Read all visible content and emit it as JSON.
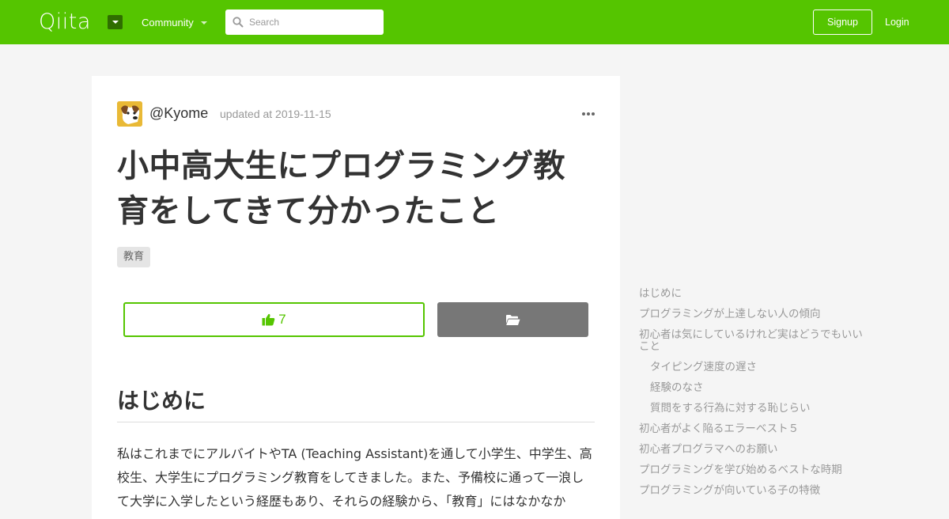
{
  "header": {
    "logo": "Qiita",
    "community_label": "Community",
    "search_placeholder": "Search",
    "signup_label": "Signup",
    "login_label": "Login",
    "brand_color": "#55c500"
  },
  "article": {
    "author": "@Kyome",
    "updated": "updated at 2019-11-15",
    "title": "小中高大生にプログラミング教育をしてきて分かったこと",
    "tags": [
      "教育"
    ],
    "like_count": "7",
    "section_heading": "はじめに",
    "paragraph": "私はこれまでにアルバイトやTA (Teaching Assistant)を通して小学生、中学生、高校生、大学生にプログラミング教育をしてきました。また、予備校に通って一浪して大学に入学したという経歴もあり、それらの経験から、「教育」にはなかなか"
  },
  "toc": [
    {
      "label": "はじめに",
      "level": 1
    },
    {
      "label": "プログラミングが上達しない人の傾向",
      "level": 1
    },
    {
      "label": "初心者は気にしているけれど実はどうでもいいこと",
      "level": 1
    },
    {
      "label": "タイピング速度の遅さ",
      "level": 2
    },
    {
      "label": "経験のなさ",
      "level": 2
    },
    {
      "label": "質問をする行為に対する恥じらい",
      "level": 2
    },
    {
      "label": "初心者がよく陥るエラーベスト５",
      "level": 1
    },
    {
      "label": "初心者プログラマへのお願い",
      "level": 1
    },
    {
      "label": "プログラミングを学び始めるベストな時期",
      "level": 1
    },
    {
      "label": "プログラミングが向いている子の特徴",
      "level": 1
    }
  ]
}
